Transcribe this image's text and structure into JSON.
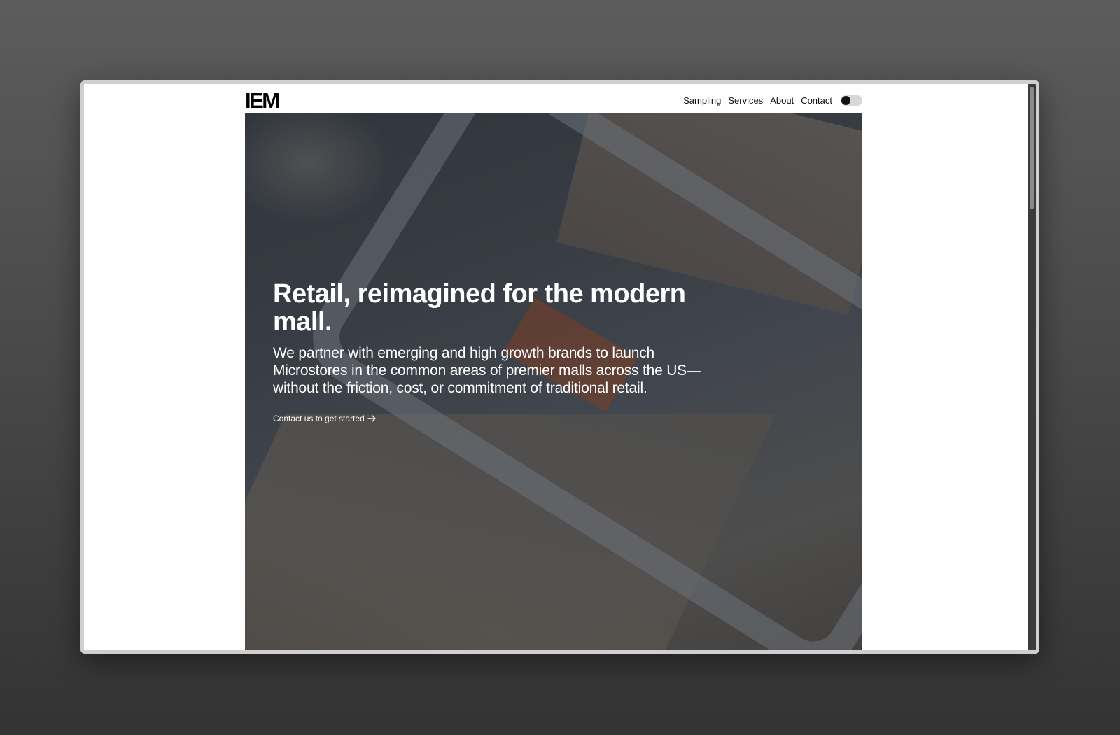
{
  "header": {
    "logo": "IEM",
    "nav": [
      {
        "label": "Sampling"
      },
      {
        "label": "Services"
      },
      {
        "label": "About"
      },
      {
        "label": "Contact"
      }
    ],
    "theme_toggle": {
      "icon": "toggle-switch",
      "state": "off"
    }
  },
  "hero": {
    "title": "Retail, reimagined for the modern mall.",
    "subtitle": "We partner with emerging and high growth brands to launch Microstores in the common areas of premier malls across the US—without the friction, cost, or commitment of traditional retail.",
    "cta_label": "Contact us to get started",
    "cta_icon": "arrow-right-icon"
  },
  "colors": {
    "page_background": "#ffffff",
    "text_dark": "#111111",
    "hero_text": "#ffffff",
    "backdrop": "#4a4a4a"
  }
}
